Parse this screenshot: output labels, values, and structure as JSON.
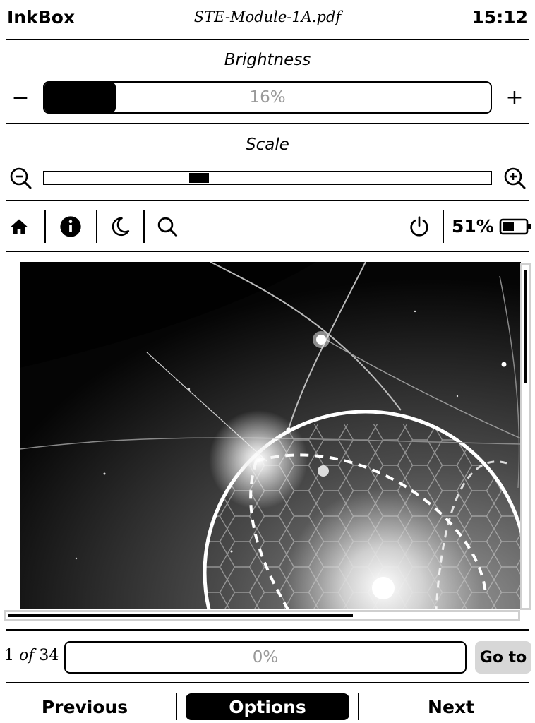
{
  "header": {
    "app_name": "InkBox",
    "document_title": "STE-Module-1A.pdf",
    "time": "15:12"
  },
  "brightness": {
    "title": "Brightness",
    "decrease_label": "−",
    "increase_label": "+",
    "value_text": "16%",
    "value": 0.16
  },
  "scale": {
    "title": "Scale",
    "position": 0.34
  },
  "toolbar": {
    "icons": [
      "home-icon",
      "info-icon",
      "moon-icon",
      "search-icon",
      "power-icon",
      "battery-icon"
    ],
    "battery_text": "51%",
    "battery_level": 0.51
  },
  "pagination": {
    "current": "1",
    "of": "of",
    "total": "34",
    "progress_text": "0%",
    "goto_label": "Go to"
  },
  "bottom_bar": {
    "previous_label": "Previous",
    "options_label": "Options",
    "next_label": "Next"
  }
}
